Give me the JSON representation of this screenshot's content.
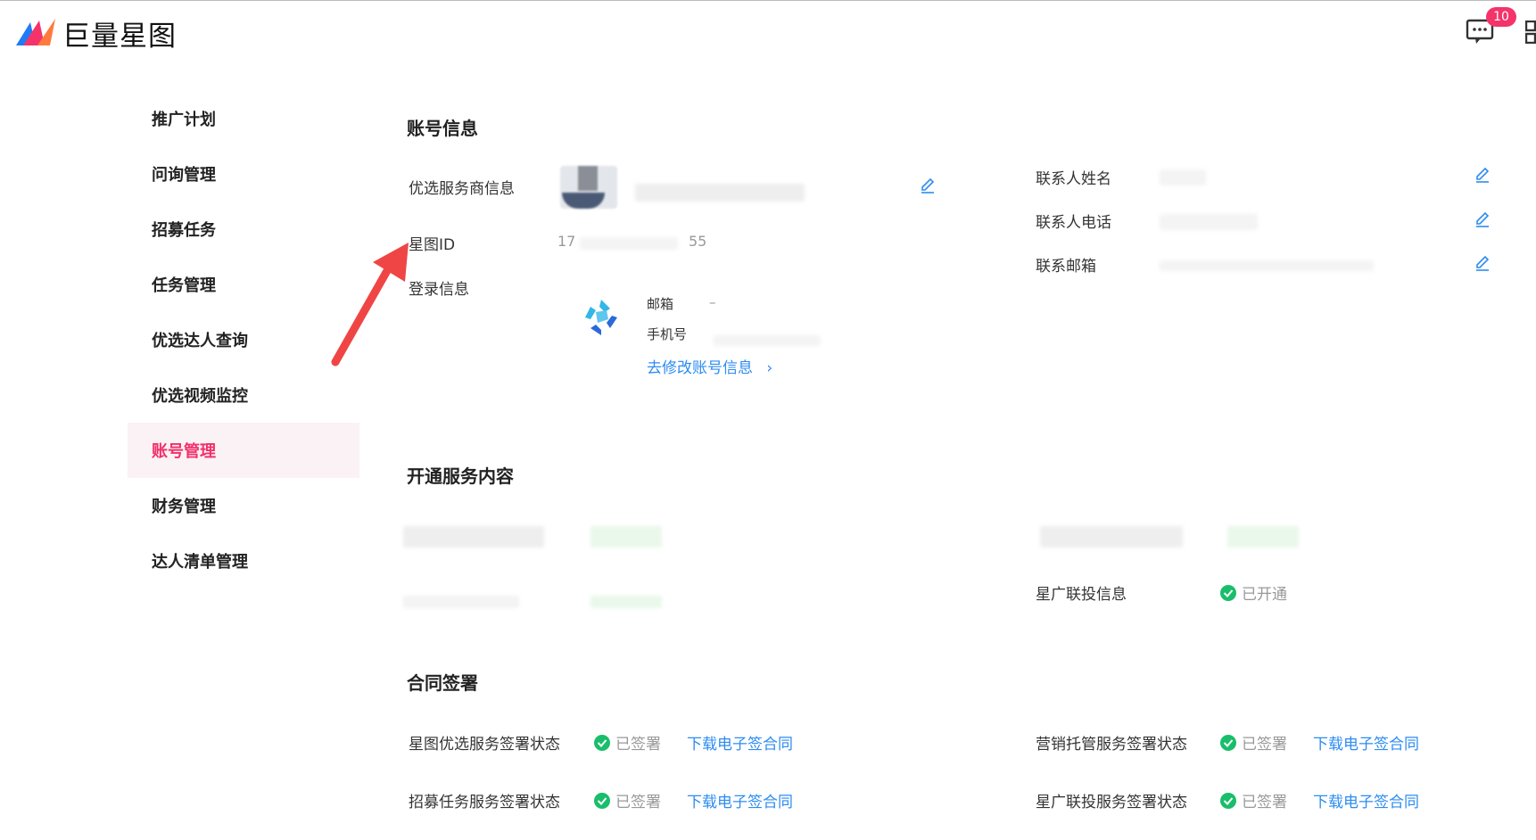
{
  "header": {
    "logo_text": "巨量星图",
    "message_badge": "10",
    "brand_colors": {
      "pink": "#f2306a",
      "blue": "#2d8cf0",
      "green": "#19be6b"
    }
  },
  "sidebar": {
    "items": [
      {
        "label": "推广计划"
      },
      {
        "label": "问询管理"
      },
      {
        "label": "招募任务"
      },
      {
        "label": "任务管理"
      },
      {
        "label": "优选达人查询"
      },
      {
        "label": "优选视频监控"
      },
      {
        "label": "账号管理",
        "active": true
      },
      {
        "label": "财务管理"
      },
      {
        "label": "达人清单管理"
      }
    ]
  },
  "account_info": {
    "title": "账号信息",
    "provider_label": "优选服务商信息",
    "xingtu_id_label": "星图ID",
    "xingtu_id_prefix": "17",
    "xingtu_id_suffix": "55",
    "login_label": "登录信息",
    "email_label": "邮箱",
    "email_value": "–",
    "phone_label": "手机号",
    "edit_account_link": "去修改账号信息",
    "contact_name_label": "联系人姓名",
    "contact_phone_label": "联系人电话",
    "contact_email_label": "联系邮箱"
  },
  "services": {
    "title": "开通服务内容",
    "xingguang_label": "星广联投信息",
    "xingguang_status": "已开通"
  },
  "contracts": {
    "title": "合同签署",
    "rows": [
      {
        "label": "星图优选服务签署状态",
        "status": "已签署",
        "link": "下载电子签合同"
      },
      {
        "label": "营销托管服务签署状态",
        "status": "已签署",
        "link": "下载电子签合同"
      },
      {
        "label": "招募任务服务签署状态",
        "status": "已签署",
        "link": "下载电子签合同"
      },
      {
        "label": "星广联投服务签署状态",
        "status": "已签署",
        "link": "下载电子签合同"
      }
    ]
  }
}
